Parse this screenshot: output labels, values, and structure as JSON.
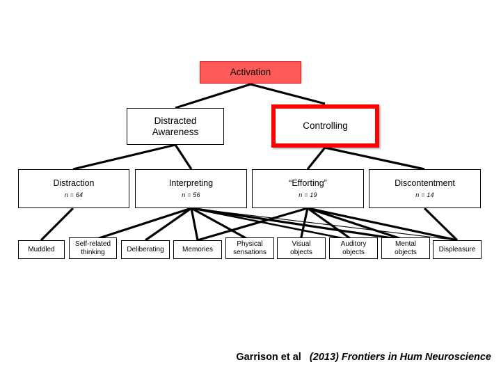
{
  "diagram": {
    "type": "hierarchy-tree",
    "levels": [
      {
        "name": "level-1",
        "nodes": [
          {
            "id": "activation",
            "label": "Activation",
            "fill": "#ff5a5a",
            "border": "#ff0000",
            "highlight": "filled"
          }
        ]
      },
      {
        "name": "level-2",
        "nodes": [
          {
            "id": "distracted-awareness",
            "label": "Distracted\nAwareness",
            "line1": "Distracted",
            "line2": "Awareness",
            "fill": "#ffffff",
            "border": "#000000",
            "highlight": "none"
          },
          {
            "id": "controlling",
            "label": "Controlling",
            "fill": "#ffffff",
            "border": "#ff0000",
            "highlight": "outlined"
          }
        ]
      },
      {
        "name": "level-3",
        "nodes": [
          {
            "id": "distraction",
            "label": "Distraction",
            "count": "n = 64"
          },
          {
            "id": "interpreting",
            "label": "Interpreting",
            "count": "n = 56"
          },
          {
            "id": "efforting",
            "label": "“Efforting”",
            "count": "n = 19"
          },
          {
            "id": "discontentment",
            "label": "Discontentment",
            "count": "n = 14"
          }
        ]
      },
      {
        "name": "level-4",
        "nodes": [
          {
            "id": "muddled",
            "line1": "Muddled",
            "line2": ""
          },
          {
            "id": "self-related-thinking",
            "line1": "Self-related",
            "line2": "thinking"
          },
          {
            "id": "deliberating",
            "line1": "Deliberating",
            "line2": ""
          },
          {
            "id": "memories",
            "line1": "Memories",
            "line2": ""
          },
          {
            "id": "physical-sensations",
            "line1": "Physical",
            "line2": "sensations"
          },
          {
            "id": "visual-objects",
            "line1": "Visual",
            "line2": "objects"
          },
          {
            "id": "auditory-objects",
            "line1": "Auditory",
            "line2": "objects"
          },
          {
            "id": "mental-objects",
            "line1": "Mental",
            "line2": "objects"
          },
          {
            "id": "displeasure",
            "line1": "Displeasure",
            "line2": ""
          }
        ]
      }
    ]
  },
  "citation": {
    "authors": "Garrison et al",
    "source": "(2013) Frontiers in Hum Neuroscience"
  }
}
